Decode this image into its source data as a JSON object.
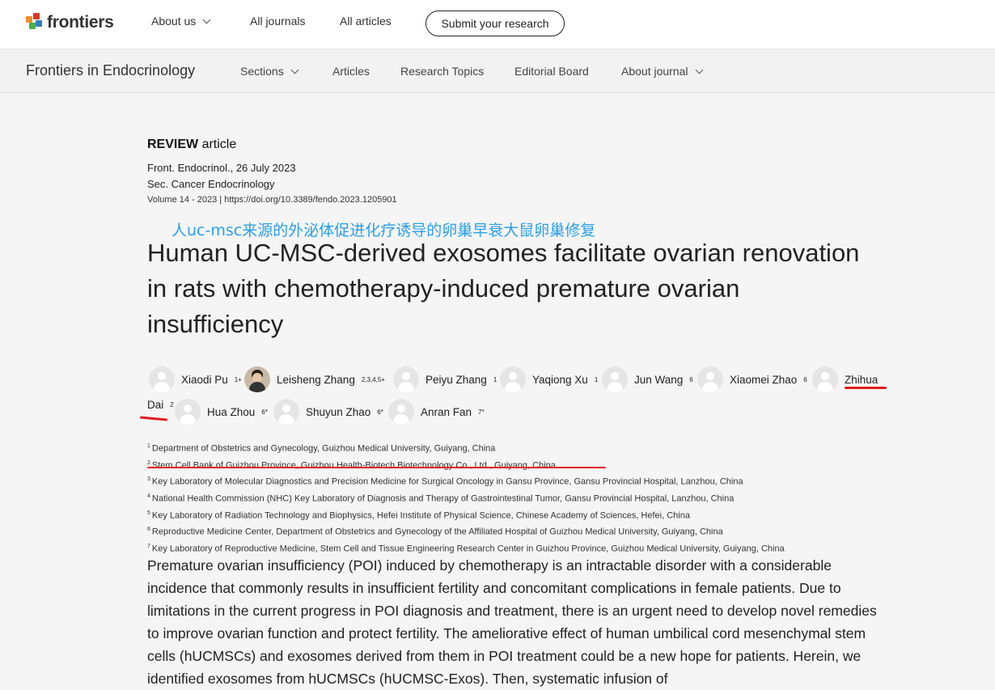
{
  "topnav": {
    "logo_text": "frontiers",
    "about_us": "About us",
    "all_journals": "All journals",
    "all_articles": "All articles",
    "submit": "Submit your research"
  },
  "journalnav": {
    "journal_name": "Frontiers in Endocrinology",
    "sections": "Sections",
    "articles": "Articles",
    "research_topics": "Research Topics",
    "editorial_board": "Editorial Board",
    "about_journal": "About journal"
  },
  "article": {
    "type_bold": "REVIEW",
    "type_rest": " article",
    "journal_date": "Front. Endocrinol., 26 July 2023",
    "section": "Sec. Cancer Endocrinology",
    "volume_doi": "Volume 14 - 2023 | https://doi.org/10.3389/fendo.2023.1205901",
    "annotation_cn": "人uc-msc来源的外泌体促进化疗诱导的卵巢早衰大鼠卵巢修复",
    "title": "Human UC-MSC-derived exosomes facilitate ovarian renovation in rats with chemotherapy-induced premature ovarian insufficiency",
    "authors": [
      {
        "name": "Xiaodi Pu",
        "sup": "1+"
      },
      {
        "name": "Leisheng Zhang",
        "sup": "2,3,4,5+"
      },
      {
        "name": "Peiyu Zhang",
        "sup": "1"
      },
      {
        "name": "Yaqiong Xu",
        "sup": "1"
      },
      {
        "name": "Jun Wang",
        "sup": "6"
      },
      {
        "name": "Xiaomei Zhao",
        "sup": "6"
      },
      {
        "name": "Zhihua",
        "sup": ""
      },
      {
        "name": "Dai",
        "sup": "2"
      },
      {
        "name": "Hua Zhou",
        "sup": "6*"
      },
      {
        "name": "Shuyun Zhao",
        "sup": "6*"
      },
      {
        "name": "Anran Fan",
        "sup": "7*"
      }
    ],
    "affiliations": [
      {
        "num": "1",
        "text": "Department of Obstetrics and Gynecology, Guizhou Medical University, Guiyang, China"
      },
      {
        "num": "2",
        "text": "Stem Cell Bank of Guizhou Province, Guizhou Health-Biotech Biotechnology Co., Ltd., Guiyang, China"
      },
      {
        "num": "3",
        "text": "Key Laboratory of Molecular Diagnostics and Precision Medicine for Surgical Oncology in Gansu Province, Gansu Provincial Hospital, Lanzhou, China"
      },
      {
        "num": "4",
        "text": "National Health Commission (NHC) Key Laboratory of Diagnosis and Therapy of Gastrointestinal Tumor, Gansu Provincial Hospital, Lanzhou, China"
      },
      {
        "num": "5",
        "text": "Key Laboratory of Radiation Technology and Biophysics, Hefei Institute of Physical Science, Chinese Academy of Sciences, Hefei, China"
      },
      {
        "num": "6",
        "text": "Reproductive Medicine Center, Department of Obstetrics and Gynecology of the Affiliated Hospital of Guizhou Medical University, Guiyang, China"
      },
      {
        "num": "7",
        "text": "Key Laboratory of Reproductive Medicine, Stem Cell and Tissue Engineering Research Center in Guizhou Province, Guizhou Medical University, Guiyang, China"
      }
    ],
    "abstract": "Premature ovarian insufficiency (POI) induced by chemotherapy is an intractable disorder with a considerable incidence that commonly results in insufficient fertility and concomitant complications in female patients. Due to limitations in the current progress in POI diagnosis and treatment, there is an urgent need to develop novel remedies to improve ovarian function and protect fertility. The ameliorative effect of human umbilical cord mesenchymal stem cells (hUCMSCs) and exosomes derived from them in POI treatment could be a new hope for patients. Herein, we identified exosomes from hUCMSCs (hUCMSC-Exos). Then, systematic infusion of"
  },
  "colors": {
    "annotation_blue": "#2aa0e8",
    "underline_red": "#e01e1e",
    "logo_orange": "#f28c28",
    "logo_green": "#4cae4c",
    "logo_blue": "#2f7fc1",
    "logo_red": "#d9372b"
  }
}
